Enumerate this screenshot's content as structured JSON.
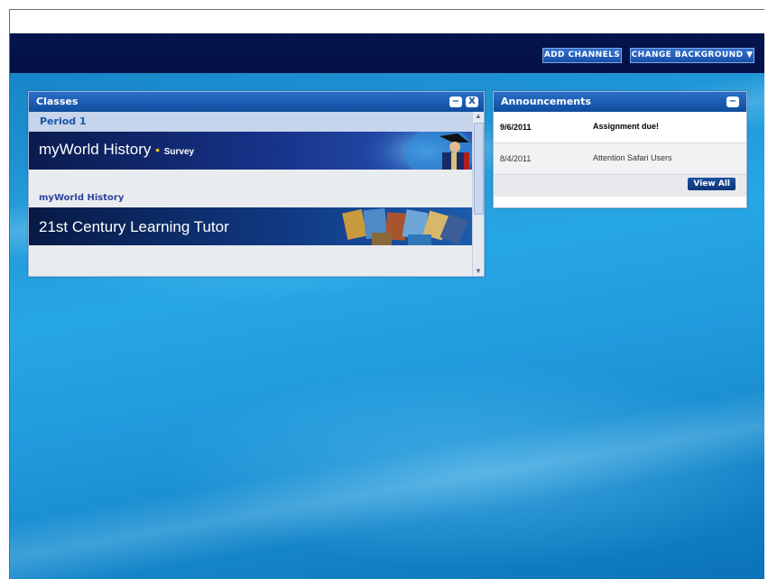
{
  "topbar": {
    "add_channels": "ADD CHANNELS",
    "change_background": "CHANGE BACKGROUND",
    "change_background_arrow": "▼"
  },
  "classes": {
    "title": "Classes",
    "minimize": "−",
    "close": "X",
    "period": "Period 1",
    "course1": {
      "title": "myWorld History",
      "dot": "•",
      "subtitle": "Survey"
    },
    "course2_link": "myWorld History",
    "course3": {
      "title": "21st Century Learning Tutor"
    },
    "scroll_up": "▲",
    "scroll_down": "▼"
  },
  "announcements": {
    "title": "Announcements",
    "minimize": "−",
    "items": [
      {
        "date": "9/6/2011",
        "title": "Assignment due!",
        "bold": true
      },
      {
        "date": "8/4/2011",
        "title": "Attention Safari Users",
        "bold": false
      }
    ],
    "view_all": "View All"
  }
}
